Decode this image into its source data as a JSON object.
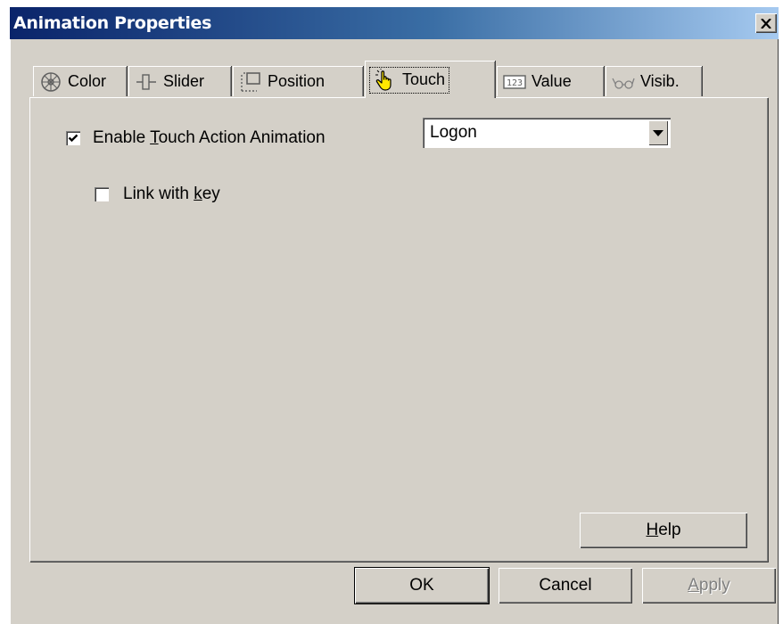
{
  "window": {
    "title": "Animation Properties"
  },
  "tabs": [
    {
      "label": "Color",
      "icon": "color-wheel-icon"
    },
    {
      "label": "Slider",
      "icon": "slider-icon"
    },
    {
      "label": "Position",
      "icon": "position-icon"
    },
    {
      "label": "Touch",
      "icon": "hand-pointer-icon",
      "active": true
    },
    {
      "label": "Value",
      "icon": "value-123-icon"
    },
    {
      "label": "Visib.",
      "icon": "glasses-icon"
    }
  ],
  "touch_panel": {
    "enable_label_prefix": "Enable ",
    "enable_label_hotkey": "T",
    "enable_label_suffix": "ouch Action Animation",
    "enable_checked": true,
    "action_selected": "Logon",
    "link_label_prefix": "Link with ",
    "link_label_hotkey": "k",
    "link_label_suffix": "ey",
    "link_checked": false
  },
  "buttons": {
    "help_hotkey": "H",
    "help_rest": "elp",
    "ok": "OK",
    "cancel": "Cancel",
    "apply_hotkey": "A",
    "apply_rest": "pply"
  }
}
